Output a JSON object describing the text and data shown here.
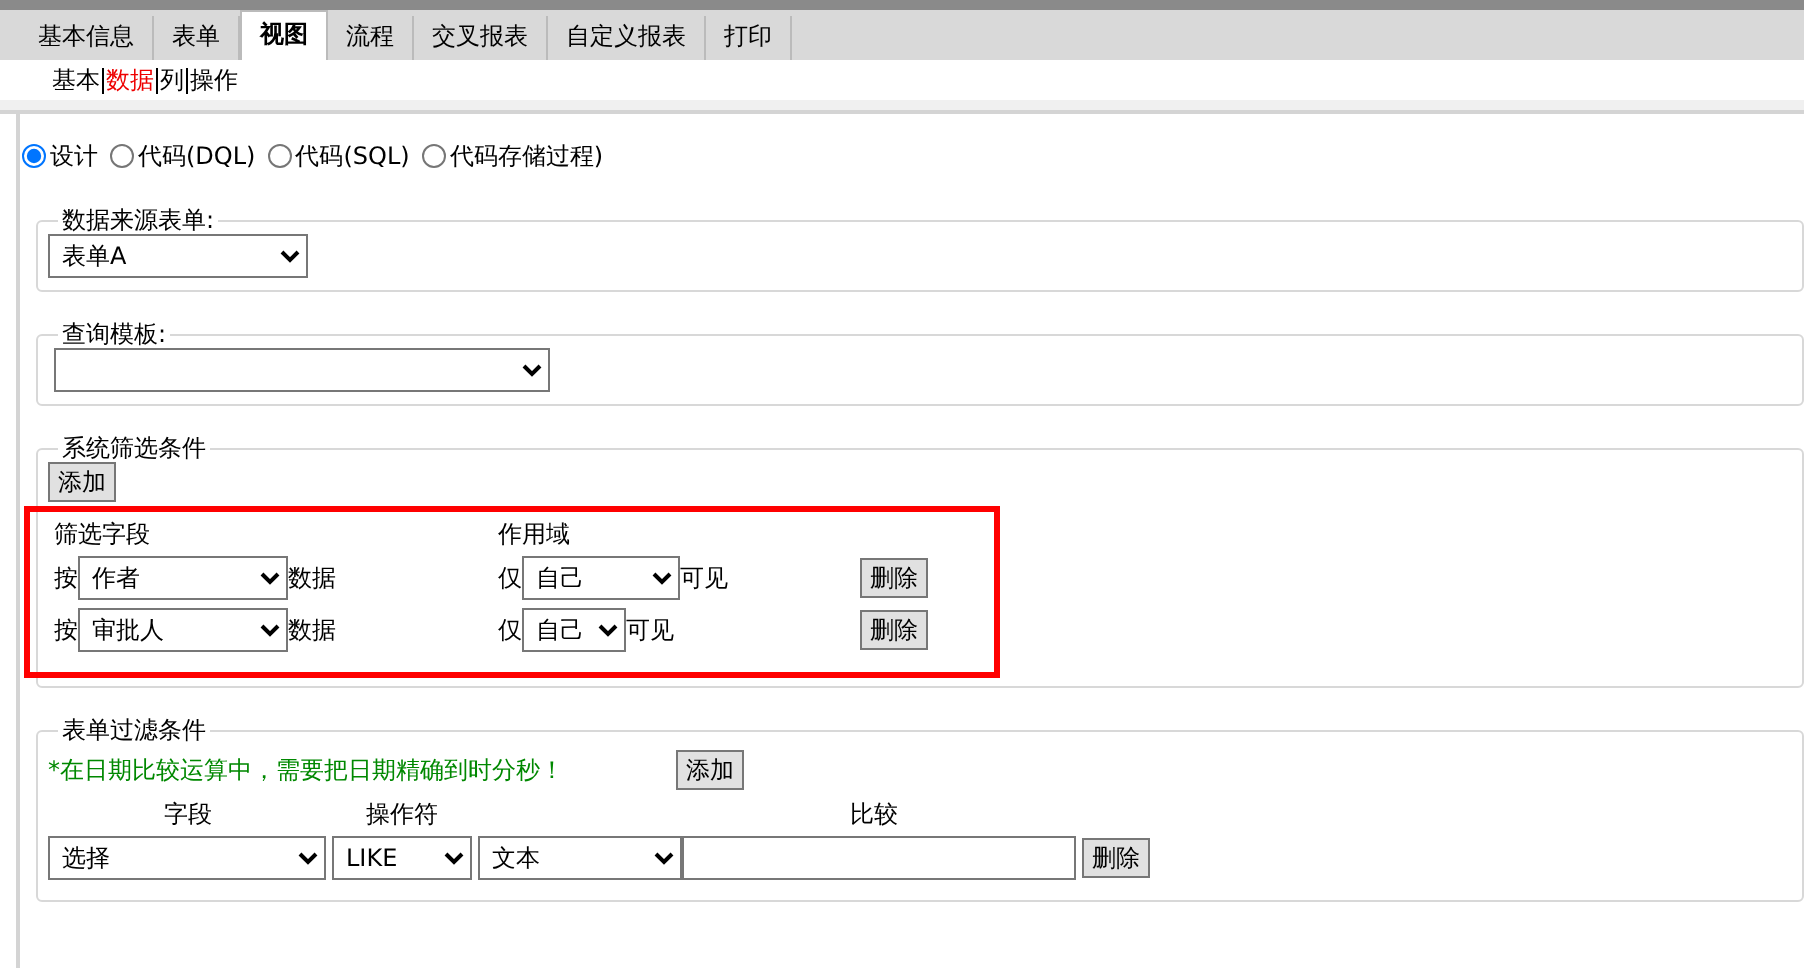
{
  "tabs": [
    {
      "label": "基本信息",
      "selected": false
    },
    {
      "label": "表单",
      "selected": false
    },
    {
      "label": "视图",
      "selected": true
    },
    {
      "label": "流程",
      "selected": false
    },
    {
      "label": "交叉报表",
      "selected": false
    },
    {
      "label": "自定义报表",
      "selected": false
    },
    {
      "label": "打印",
      "selected": false
    }
  ],
  "subtabs": [
    {
      "label": "基本",
      "selected": false
    },
    {
      "label": "数据",
      "selected": true
    },
    {
      "label": "列",
      "selected": false
    },
    {
      "label": "操作",
      "selected": false
    }
  ],
  "mode_options": [
    {
      "label": "设计",
      "selected": true
    },
    {
      "label": "代码(DQL)",
      "selected": false
    },
    {
      "label": "代码(SQL)",
      "selected": false
    },
    {
      "label": "代码存储过程)",
      "selected": false
    }
  ],
  "data_source": {
    "legend": "数据来源表单:",
    "value": "表单A"
  },
  "query_template": {
    "legend": "查询模板:"
  },
  "system_filter": {
    "legend": "系统筛选条件",
    "add_button": "添加",
    "column_headers": [
      "筛选字段",
      "作用域"
    ],
    "rows": [
      {
        "prefix": "按",
        "field": "作者",
        "suffix": "数据",
        "scope_prefix": "仅",
        "scope": "自己",
        "scope_suffix": "可见",
        "delete_button": "删除"
      },
      {
        "prefix": "按",
        "field": "审批人",
        "suffix": "数据",
        "scope_prefix": "仅",
        "scope": "自己",
        "scope_suffix": "可见",
        "delete_button": "删除"
      }
    ]
  },
  "form_filter": {
    "legend": "表单过滤条件",
    "note": "*在日期比较运算中，需要把日期精确到时分秒！",
    "add_button": "添加",
    "column_headers": [
      "字段",
      "操作符",
      "比较"
    ],
    "rows": [
      {
        "field": "选择",
        "operator": "LIKE",
        "value_type": "文本",
        "delete_button": "删除"
      }
    ]
  }
}
